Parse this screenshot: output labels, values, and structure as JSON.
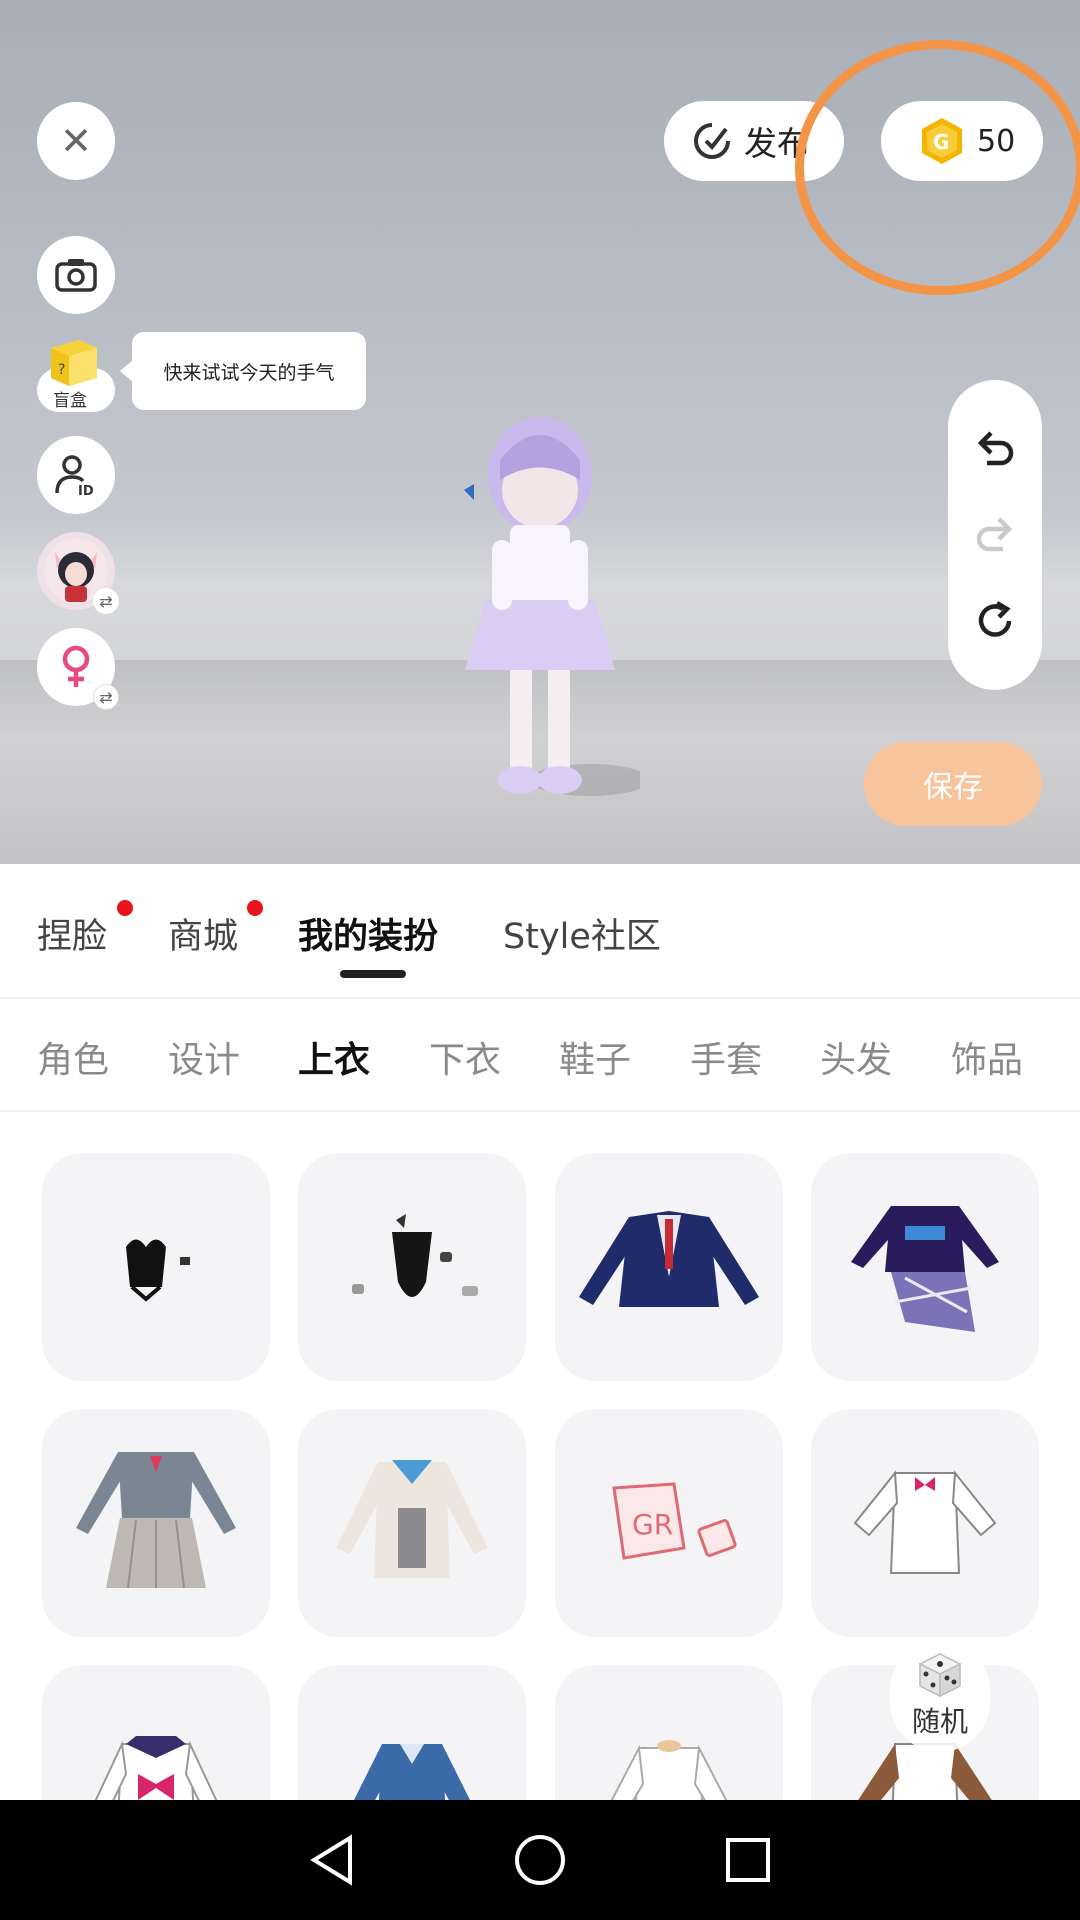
{
  "stage": {
    "publish_label": "发布",
    "coin_count": "50",
    "blindbox_label": "盲盒",
    "tooltip": "快来试试今天的手气",
    "save_label": "保存"
  },
  "main_tabs": [
    {
      "label": "捏脸",
      "badge": true
    },
    {
      "label": "商城",
      "badge": true
    },
    {
      "label": "我的装扮",
      "active": true
    },
    {
      "label": "Style社区"
    }
  ],
  "sub_tabs": [
    {
      "label": "角色"
    },
    {
      "label": "设计"
    },
    {
      "label": "上衣",
      "active": true
    },
    {
      "label": "下衣"
    },
    {
      "label": "鞋子"
    },
    {
      "label": "手套"
    },
    {
      "label": "头发"
    },
    {
      "label": "饰品"
    }
  ],
  "grid": {
    "items": [
      "black-bow-top",
      "black-bodysuit",
      "navy-school-blazer",
      "purple-sweater-plaid-skirt",
      "grey-uniform-pleated-skirt",
      "white-cardigan-sailor",
      "pink-print-tshirt",
      "white-shirt-pink-bow",
      "white-sailor-pink-bow",
      "blue-shirt",
      "white-dress-shirt",
      "brown-jacket"
    ]
  },
  "random_label": "随机",
  "colors": {
    "accent_orange": "#f39447",
    "save_button": "#f8c49b",
    "badge_red": "#e8141c",
    "coin_gold": "#f4b400"
  }
}
